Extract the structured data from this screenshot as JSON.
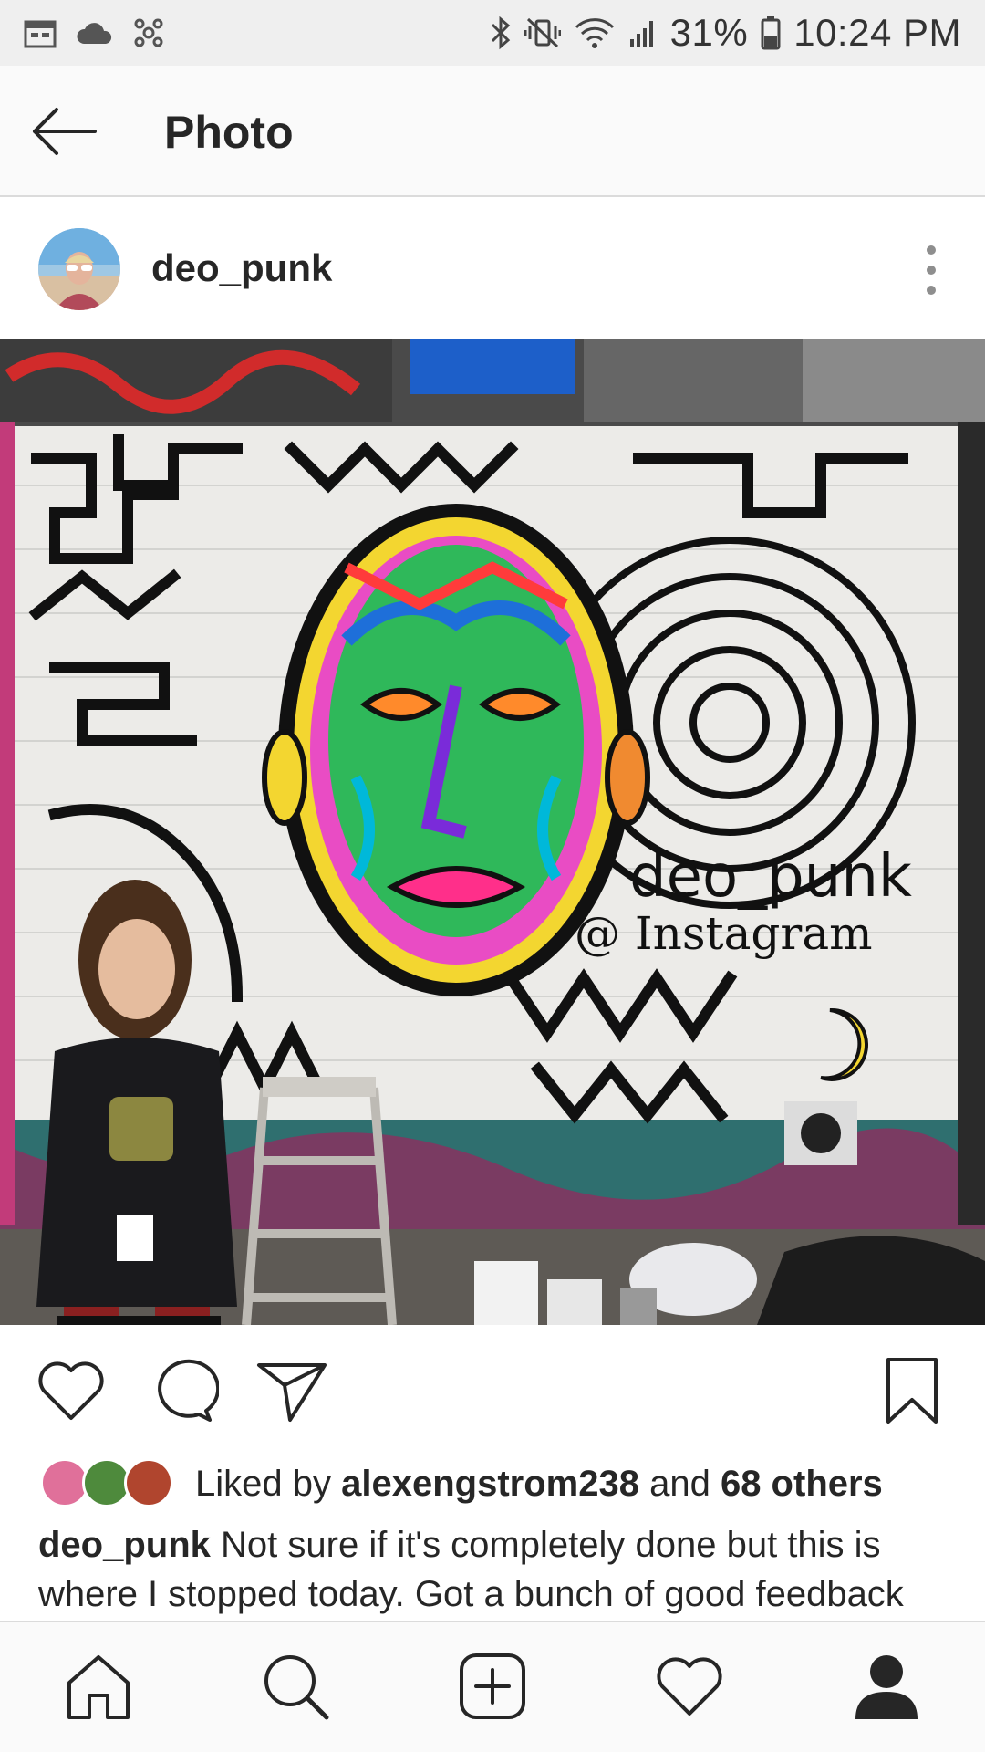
{
  "status_bar": {
    "icons_left": [
      "calendar-icon",
      "cloud-icon",
      "app-icon"
    ],
    "icons_right": [
      "bluetooth-icon",
      "vibrate-off-icon",
      "wifi-icon",
      "signal-icon"
    ],
    "battery": "31%",
    "time": "10:24 PM"
  },
  "header": {
    "title": "Photo"
  },
  "post": {
    "username": "deo_punk",
    "photo": {
      "wall_text_line1": "deo_punk",
      "wall_text_line2": "@ Instagram"
    },
    "likes": {
      "prefix": "Liked by",
      "user": "alexengstrom238",
      "and": "and",
      "others": "68 others"
    },
    "caption": {
      "username": "deo_punk",
      "text": "Not sure if it's completely done but this is where I stopped today. Got a bunch of good feedback"
    }
  },
  "bottom_nav": [
    "home-icon",
    "search-icon",
    "add-post-icon",
    "activity-heart-icon",
    "profile-icon"
  ],
  "colors": {
    "text": "#262626",
    "statusbar_bg": "#efefef",
    "bar_bg": "#fafafa",
    "divider": "#dbdbdb"
  }
}
